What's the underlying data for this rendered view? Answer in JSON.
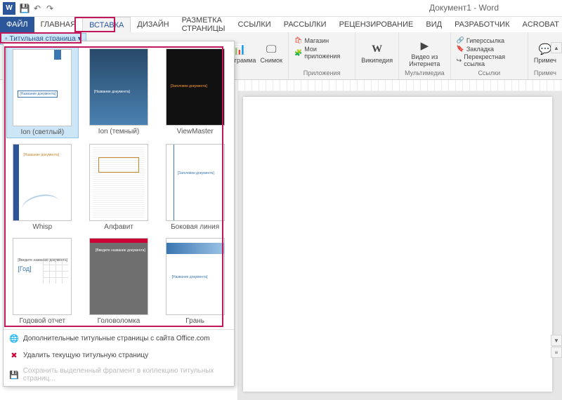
{
  "app": {
    "doc_title": "Документ1 - Word"
  },
  "qat": {
    "save": "💾",
    "undo": "↶",
    "redo": "↷"
  },
  "tabs": {
    "file": "ФАЙЛ",
    "home": "ГЛАВНАЯ",
    "insert": "ВСТАВКА",
    "design": "ДИЗАЙН",
    "layout": "РАЗМЕТКА СТРАНИЦЫ",
    "refs": "ССЫЛКИ",
    "mail": "РАССЫЛКИ",
    "review": "РЕЦЕНЗИРОВАНИЕ",
    "view": "ВИД",
    "dev": "РАЗРАБОТЧИК",
    "acrobat": "ACROBAT"
  },
  "title_page_btn": "Титульная страница",
  "ribbon": {
    "chart": "Диаграмма",
    "screenshot": "Снимок",
    "store": "Магазин",
    "myapps": "Мои приложения",
    "apps_group": "Приложения",
    "wikipedia": "Википедия",
    "online_video": "Видео из Интернета",
    "media_group": "Мультимедиа",
    "hyperlink": "Гиперссылка",
    "bookmark": "Закладка",
    "crossref": "Перекрестная ссылка",
    "links_group": "Ссылки",
    "comment": "Примеч",
    "comment_group": "Примеч"
  },
  "gallery": {
    "items": [
      {
        "label": "Ion (светлый)",
        "inner": "[Название документа]"
      },
      {
        "label": "Ion (темный)",
        "inner": "[Название документа]"
      },
      {
        "label": "ViewMaster",
        "inner": "[Заголовок документа]"
      },
      {
        "label": "Whisp",
        "inner": "[Название документа]"
      },
      {
        "label": "Алфавит",
        "inner": ""
      },
      {
        "label": "Боковая линия",
        "inner": "[Заголовок документа]"
      },
      {
        "label": "Годовой отчет",
        "inner": "[Год]",
        "small": "[Введите название документа]"
      },
      {
        "label": "Головоломка",
        "inner": "[Введите название документа]"
      },
      {
        "label": "Грань",
        "inner": "[Название документа]"
      }
    ],
    "more": "Дополнительные титульные страницы с сайта Office.com",
    "remove": "Удалить текущую титульную страницу",
    "save_sel": "Сохранить выделенный фрагмент в коллекцию титульных страниц..."
  }
}
